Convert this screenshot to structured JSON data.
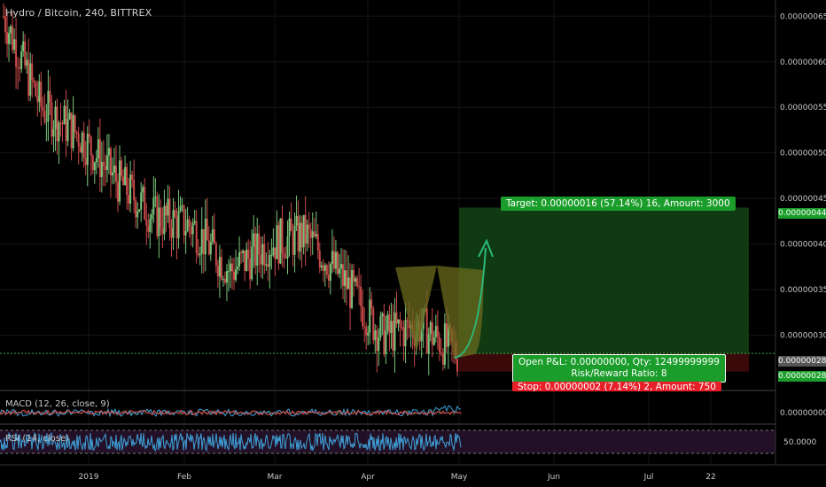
{
  "header": {
    "title": "Hydro / Bitcoin, 240, BITTREX"
  },
  "macd_label": "MACD (12, 26, close, 9)",
  "rsi_label": "RSI (14, close)",
  "position": {
    "target_label": "Target: 0.00000016 (57.14%) 16, Amount: 3000",
    "pnl_line1": "Open P&L: 0.00000000, Qty: 12499999999",
    "pnl_line2": "Risk/Reward Ratio: 8",
    "stop_label": "Stop: 0.00000002 (7.14%) 2, Amount: 750",
    "entry": 2.8e-07,
    "target": 4.4e-07,
    "stop": 2.6e-07
  },
  "price_axis": {
    "ticks": [
      "0.00000065",
      "0.00000060",
      "0.00000055",
      "0.00000050",
      "0.00000045",
      "0.00000040",
      "0.00000035",
      "0.00000030"
    ],
    "current_badges": [
      {
        "text": "0.00000044",
        "color": "#1a9d2a"
      },
      {
        "text": "0.00000028",
        "color": "#555555"
      },
      {
        "text": "0.00000028",
        "color": "#1a9d2a"
      }
    ],
    "macd_tick": "0.00000000",
    "rsi_tick": "50.0000"
  },
  "time_axis": {
    "ticks": [
      "2019",
      "Feb",
      "Mar",
      "Apr",
      "May",
      "Jun",
      "Jul",
      "22"
    ]
  },
  "colors": {
    "up": "#7ac47a",
    "down": "#c94a4a",
    "target_zone": "#0f3a12",
    "stop_zone": "#3a0a0a",
    "pattern": "#6b6a1e",
    "arrow": "#2bb87a",
    "rsi_line": "#3fa0d8",
    "rsi_band": "#2a1430"
  },
  "chart_data": {
    "type": "candlestick",
    "title": "Hydro / Bitcoin, 240, BITTREX",
    "ylim": [
      2.5e-07,
      6.6e-07
    ],
    "x": [
      "2019",
      "Feb",
      "Mar",
      "Apr",
      "May"
    ],
    "close_trend": [
      5.8e-07,
      5e-07,
      4.5e-07,
      4e-07,
      3.7e-07,
      4e-07,
      3.9e-07,
      3.6e-07,
      2.9e-07,
      3e-07,
      2.8e-07
    ],
    "series": [
      {
        "name": "",
        "values": [
          6.5e-07,
          5.5e-07,
          5.2e-07,
          4.7e-07,
          4.3e-07,
          4.2e-07,
          3.7e-07,
          4e-07,
          4.1e-07,
          3.6e-07,
          3e-07,
          3.1e-07,
          2.8e-07
        ]
      }
    ]
  }
}
